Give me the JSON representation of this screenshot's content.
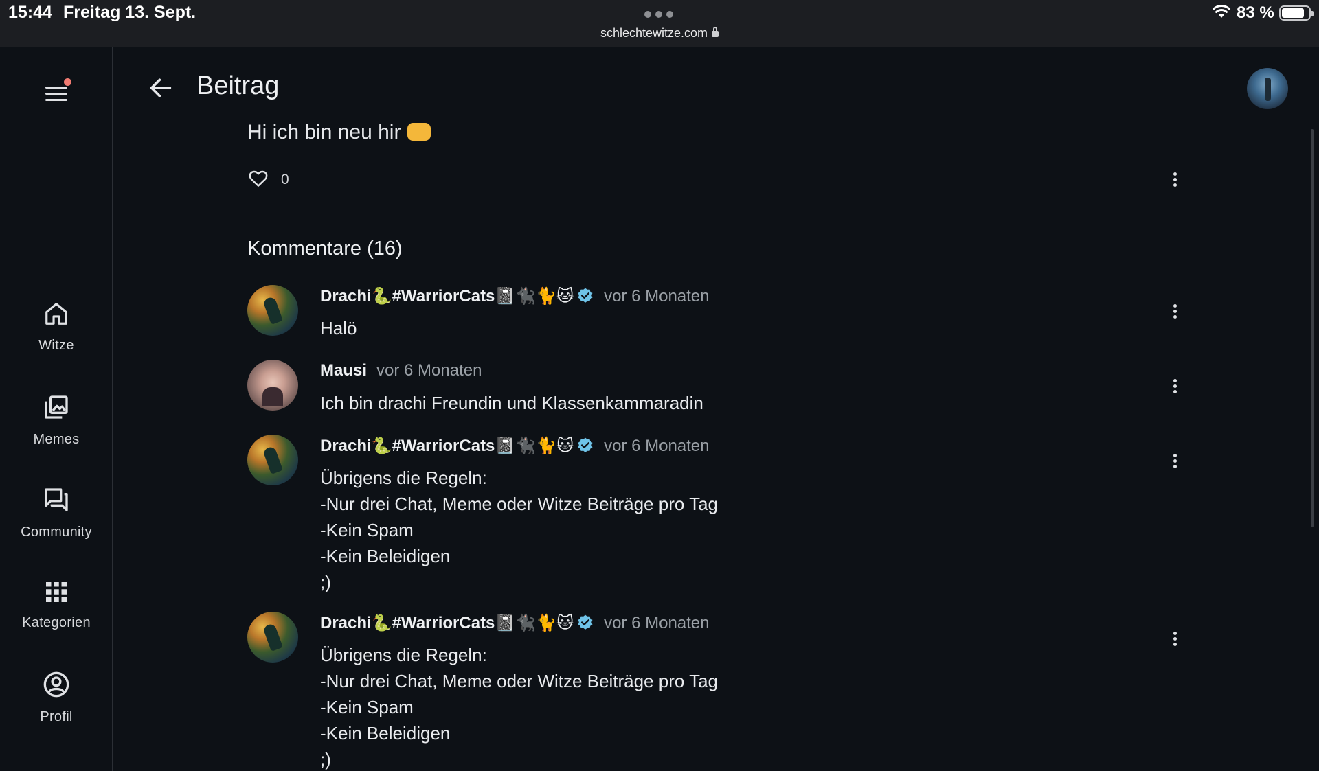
{
  "status_bar": {
    "time": "15:44",
    "date": "Freitag 13. Sept.",
    "url": "schlechtewitze.com",
    "battery": "83 %",
    "battery_level": 0.83
  },
  "nav": {
    "items": [
      {
        "label": "Witze",
        "icon": "home-icon"
      },
      {
        "label": "Memes",
        "icon": "gallery-icon"
      },
      {
        "label": "Community",
        "icon": "forum-icon"
      },
      {
        "label": "Kategorien",
        "icon": "grid-icon"
      },
      {
        "label": "Profil",
        "icon": "account-circle-icon"
      }
    ]
  },
  "header": {
    "title": "Beitrag"
  },
  "post": {
    "text": "Hi ich bin neu hir",
    "likes": "0"
  },
  "comments_section": {
    "title": "Kommentare (16)"
  },
  "comments": [
    {
      "author": "Drachi🐍#WarriorCats📓🐈‍⬛🐈🐱",
      "verified": true,
      "time": "vor 6 Monaten",
      "body": "Halö"
    },
    {
      "author": "Mausi",
      "verified": false,
      "time": "vor 6 Monaten",
      "body": "Ich bin drachi Freundin und Klassenkammaradin"
    },
    {
      "author": "Drachi🐍#WarriorCats📓🐈‍⬛🐈🐱",
      "verified": true,
      "time": "vor 6 Monaten",
      "body": "Übrigens die Regeln:\n-Nur drei Chat, Meme oder Witze Beiträge pro Tag\n-Kein Spam\n-Kein Beleidigen\n;)"
    },
    {
      "author": "Drachi🐍#WarriorCats📓🐈‍⬛🐈🐱",
      "verified": true,
      "time": "vor 6 Monaten",
      "body": "Übrigens die Regeln:\n-Nur drei Chat, Meme oder Witze Beiträge pro Tag\n-Kein Spam\n-Kein Beleidigen\n;)"
    }
  ],
  "colors": {
    "background": "#0d1116",
    "verified": "#6fc3e8",
    "notification_dot": "#f07b72"
  }
}
